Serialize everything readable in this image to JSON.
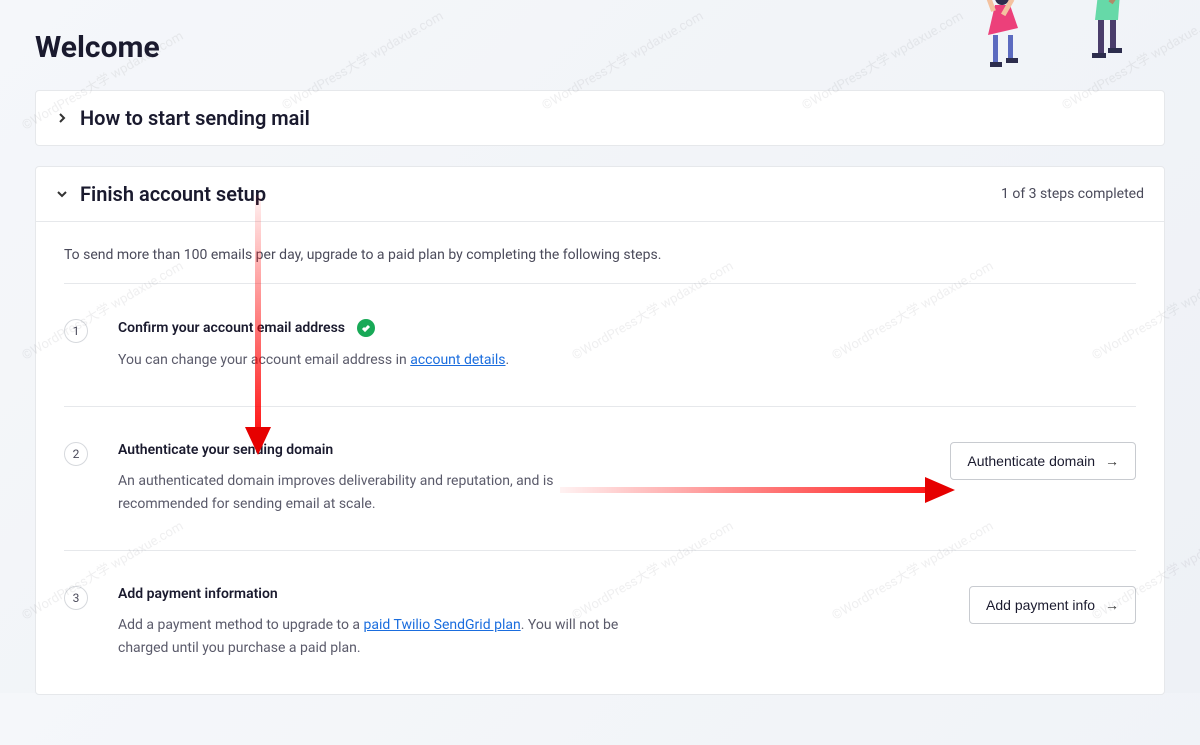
{
  "page_title": "Welcome",
  "panel1": {
    "title": "How to start sending mail"
  },
  "panel2": {
    "title": "Finish account setup",
    "progress": "1 of 3 steps completed",
    "intro": "To send more than 100 emails per day, upgrade to a paid plan by completing the following steps.",
    "steps": [
      {
        "num": "1",
        "title": "Confirm your account email address",
        "desc_before": "You can change your account email address in ",
        "link": "account details",
        "desc_after": ".",
        "completed": true
      },
      {
        "num": "2",
        "title": "Authenticate your sending domain",
        "desc": "An authenticated domain improves deliverability and reputation, and is recommended for sending email at scale.",
        "button": "Authenticate domain"
      },
      {
        "num": "3",
        "title": "Add payment information",
        "desc_before": "Add a payment method to upgrade to a ",
        "link": "paid Twilio SendGrid plan",
        "desc_after": ". You will not be charged until you purchase a paid plan.",
        "button": "Add payment info"
      }
    ]
  },
  "watermark": "©WordPress大学 wpdaxue.com"
}
